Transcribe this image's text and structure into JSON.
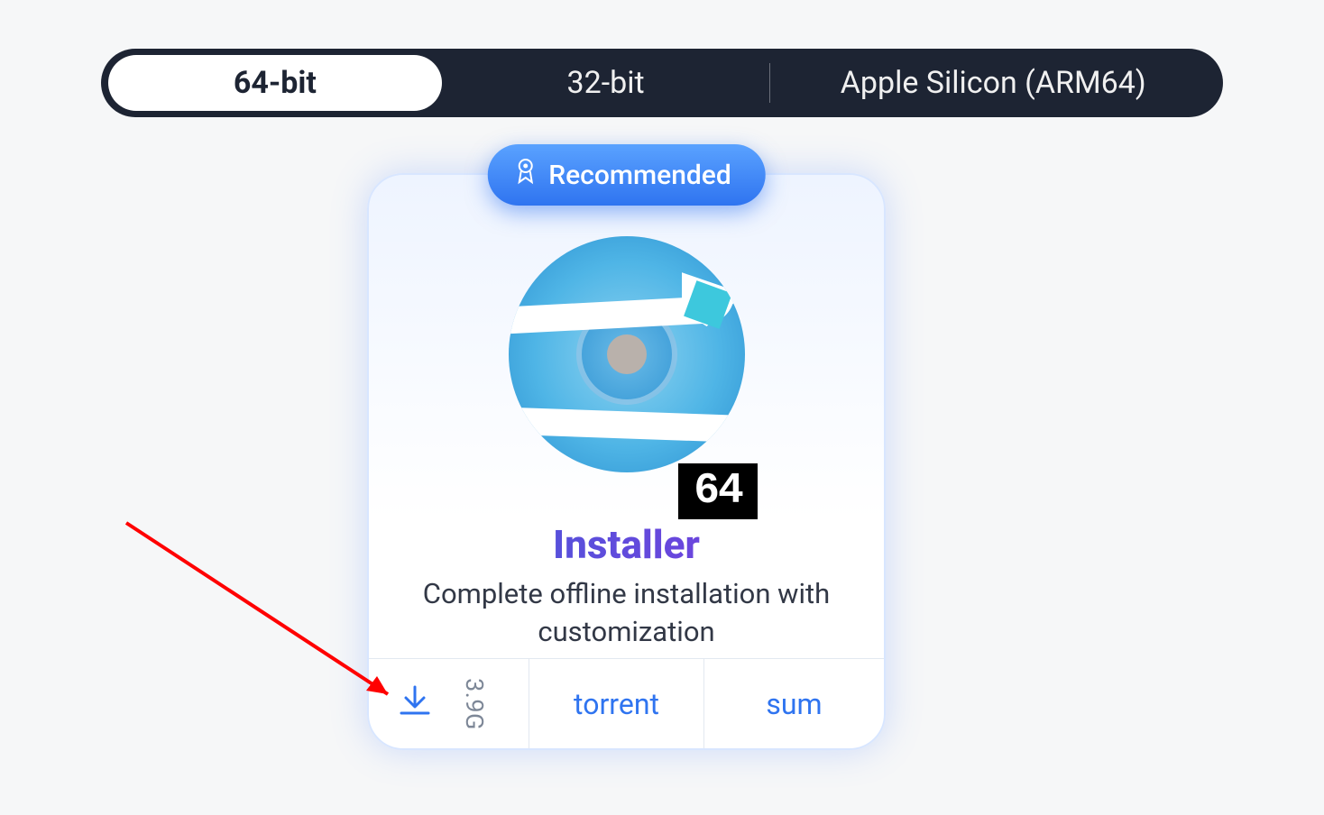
{
  "tabs": [
    {
      "label": "64-bit",
      "selected": true
    },
    {
      "label": "32-bit",
      "selected": false
    },
    {
      "label": "Apple Silicon (ARM64)",
      "selected": false
    }
  ],
  "card": {
    "recommended_label": "Recommended",
    "badge_text": "64",
    "title": "Installer",
    "subtitle": "Complete offline installation with customization",
    "download": {
      "size": "3.9G",
      "torrent_label": "torrent",
      "sum_label": "sum"
    }
  }
}
